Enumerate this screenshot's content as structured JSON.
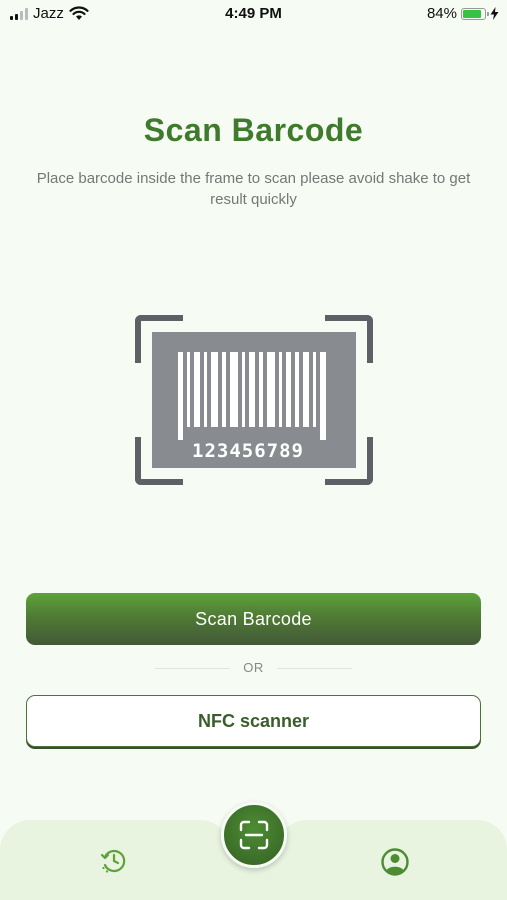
{
  "status_bar": {
    "carrier": "Jazz",
    "time": "4:49 PM",
    "battery_percent": "84%",
    "battery_level": 0.84,
    "icons": [
      "signal-icon",
      "wifi-icon",
      "battery-icon",
      "charging-icon"
    ]
  },
  "header": {
    "title": "Scan Barcode",
    "subtitle": "Place barcode inside the frame to scan please avoid shake to get result quickly"
  },
  "barcode": {
    "digits": "123456789"
  },
  "actions": {
    "scan_button_label": "Scan Barcode",
    "or_label": "OR",
    "nfc_button_label": "NFC scanner"
  },
  "bottom_nav": {
    "items": [
      "history-icon",
      "scan-icon",
      "profile-icon"
    ]
  },
  "colors": {
    "accent": "#3f7a2d",
    "button_gradient_top": "#5ea23a",
    "button_gradient_bottom": "#435838",
    "background": "#f6fbf3",
    "nav_background": "#e8f3e0"
  }
}
